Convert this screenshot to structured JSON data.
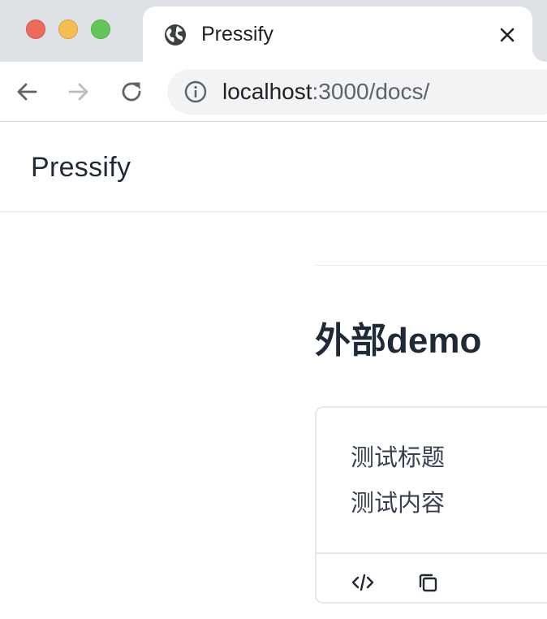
{
  "browser": {
    "tab": {
      "title": "Pressify",
      "favicon": "globe-icon"
    },
    "address_bar": {
      "host": "localhost",
      "path": ":3000/docs/"
    },
    "nav": {
      "back": "arrow-left-icon",
      "forward": "arrow-right-icon",
      "reload": "reload-icon"
    }
  },
  "site": {
    "brand": "Pressify"
  },
  "main": {
    "title": "外部demo",
    "demo": {
      "lines": [
        "测试标题",
        "测试内容"
      ],
      "actions": [
        "code-icon",
        "copy-icon"
      ]
    }
  },
  "colors": {
    "traffic_close": "#ee6a5f",
    "traffic_minimize": "#f5be4f",
    "traffic_maximize": "#62c554",
    "tabstrip": "#dee1e6",
    "text": "#1f2937",
    "border": "#e5e7eb"
  }
}
